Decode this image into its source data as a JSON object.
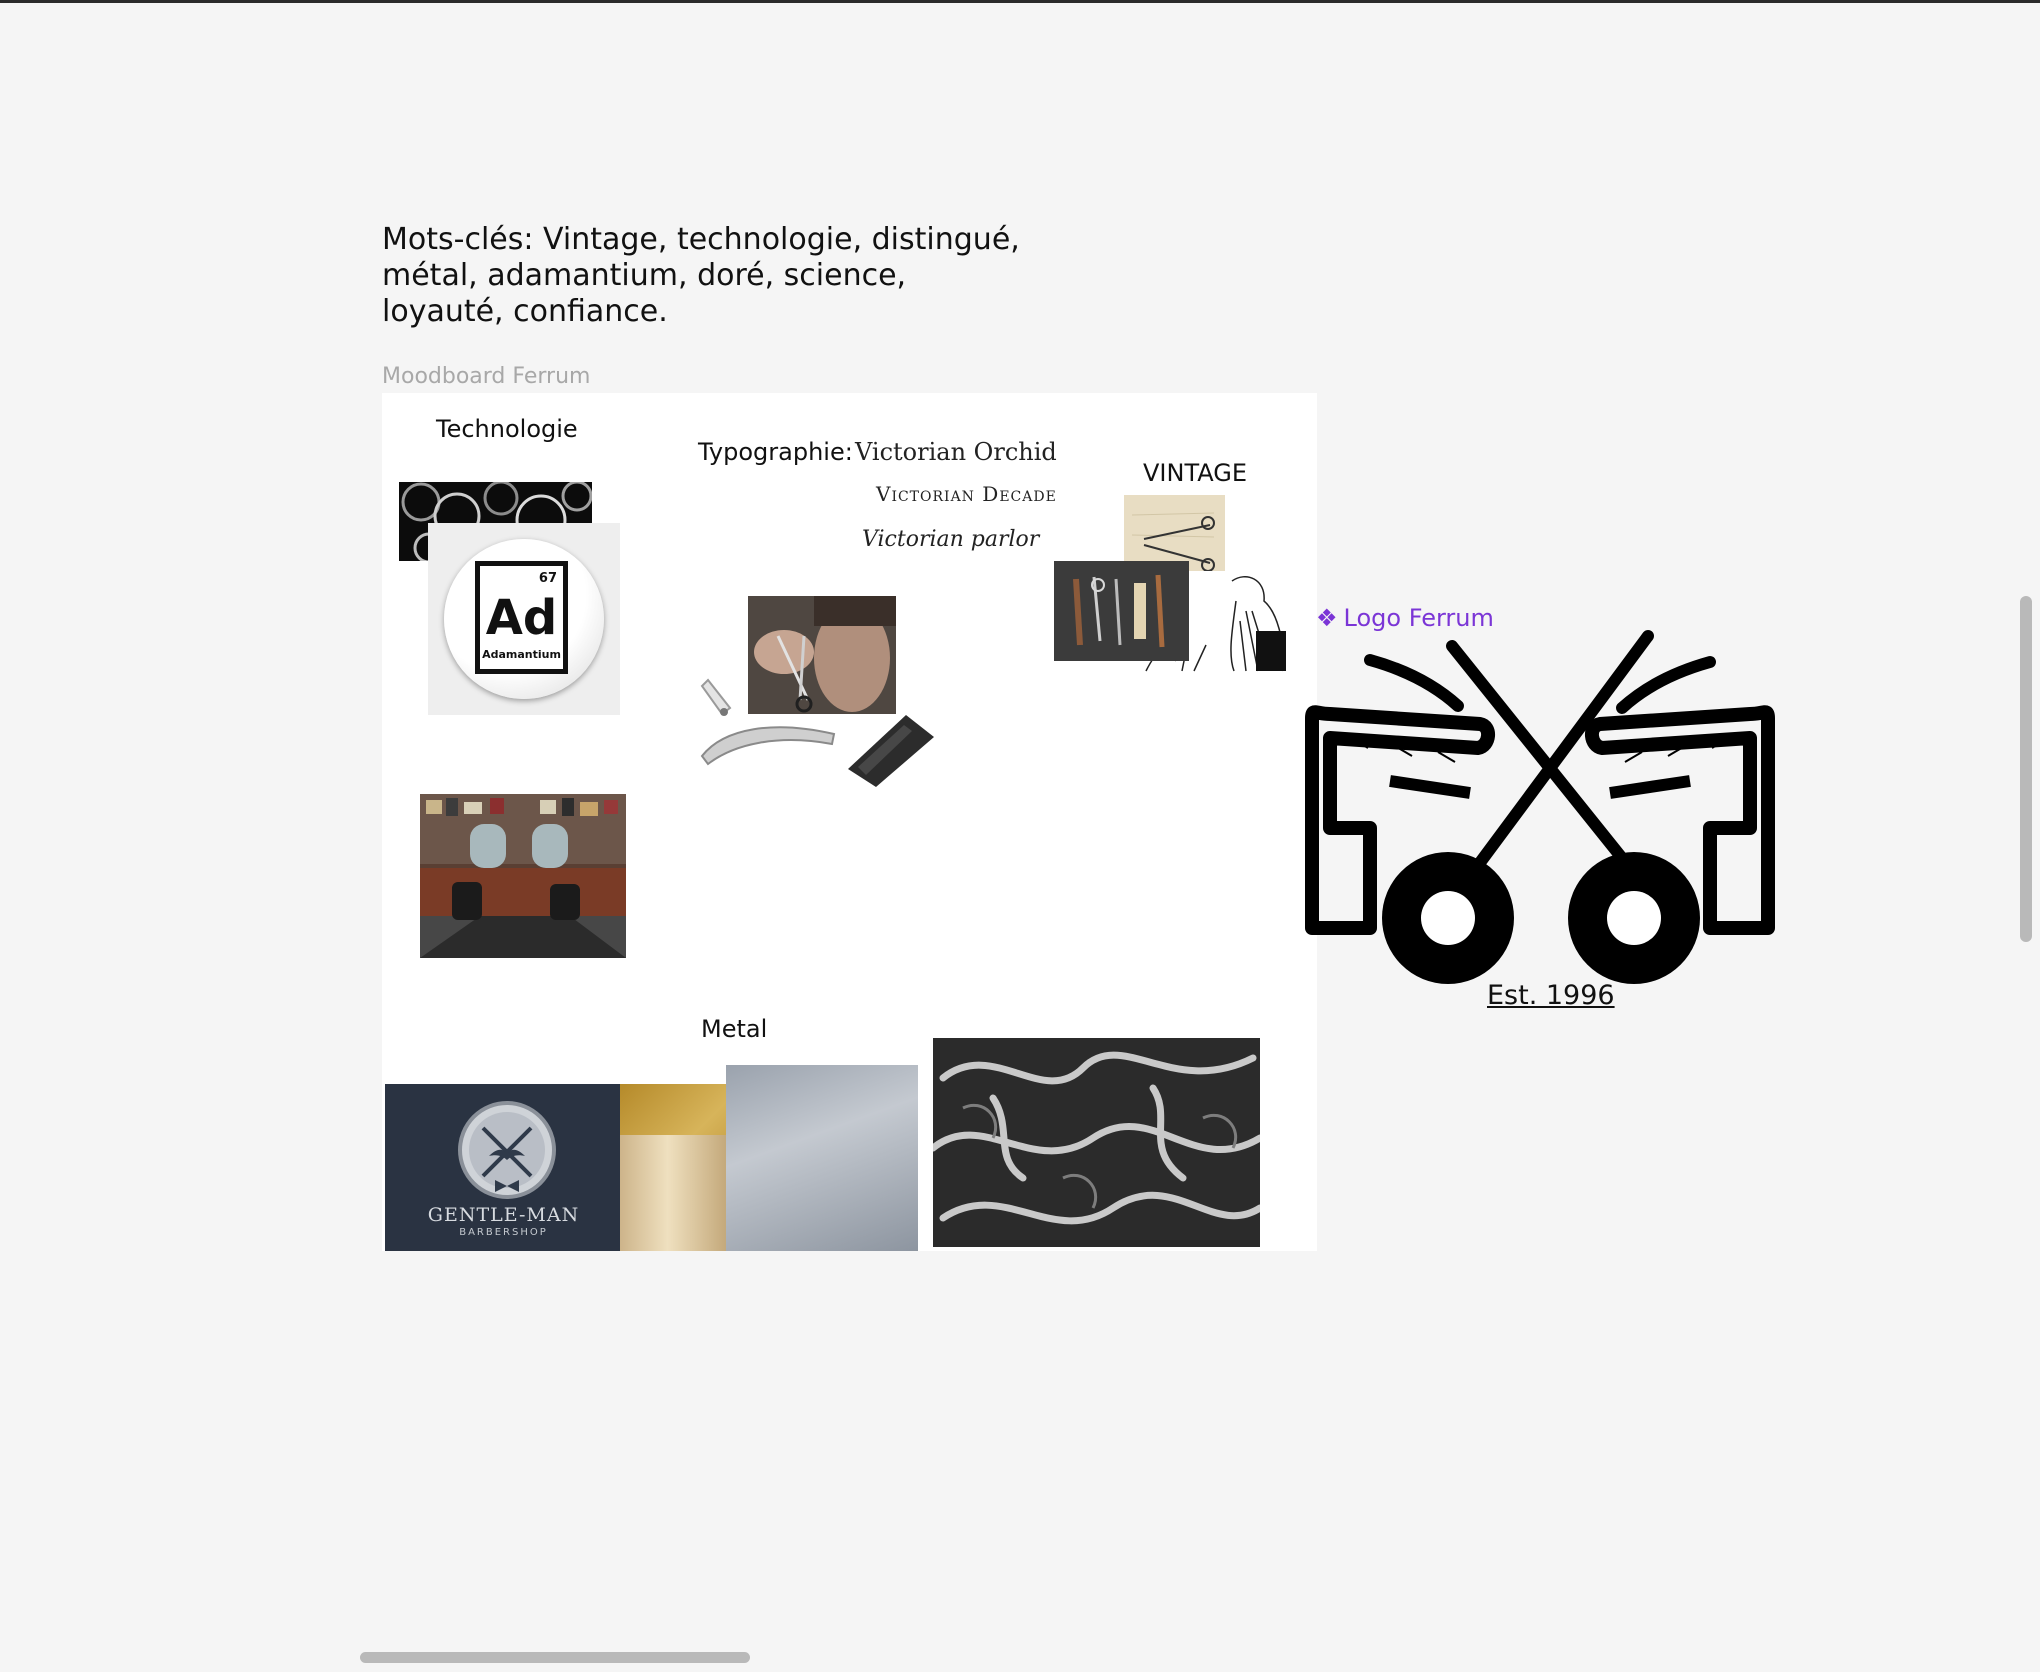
{
  "canvas": {
    "keywords": "Mots-clés: Vintage, technologie, distingué, métal, adamantium, doré, science, loyauté, confiance.",
    "frame_label": "Moodboard Ferrum"
  },
  "moodboard": {
    "section_technologie": "Technologie",
    "section_typographie": "Typographie:",
    "font_samples": [
      "Victorian Orchid",
      "Victorian Decade",
      "Victorian parlor"
    ],
    "section_vintage": "VINTAGE",
    "section_metal": "Metal",
    "adamantium_tile": {
      "number": "67",
      "symbol": "Ad",
      "name": "Adamantium"
    },
    "gentleman_sign": {
      "name": "GENTLE-MAN",
      "sub": "BARBERSHOP"
    }
  },
  "logo": {
    "component_icon": "component-diamond-icon",
    "label": "Logo Ferrum",
    "tagline": "Est. 1996",
    "accent_color": "#7b35d6"
  }
}
